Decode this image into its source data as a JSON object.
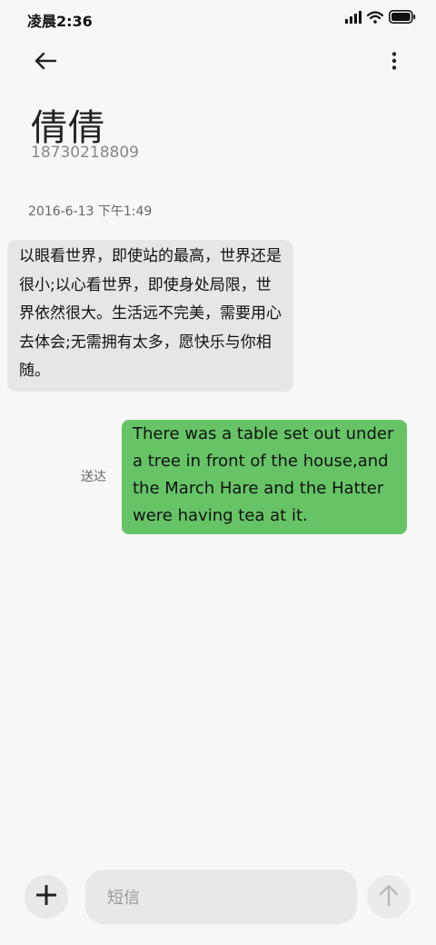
{
  "status_bar": {
    "time": "凌晨2:36",
    "icons": [
      "signal-icon",
      "wifi-icon",
      "battery-icon"
    ]
  },
  "header": {
    "back_icon": "arrow-left-icon",
    "more_icon": "more-vertical-icon"
  },
  "contact": {
    "name": "倩倩",
    "number": "18730218809"
  },
  "conversation": {
    "timestamp": "2016-6-13 下午1:49",
    "incoming_message": "以眼看世界，即使站的最高，世界还是很小;以心看世界，即使身处局限，世界依然很大。生活远不完美，需要用心去体会;无需拥有太多，愿快乐与你相随。",
    "outgoing_message": "There was a table set out under a tree in front of the house,and the March Hare and the Hatter were having tea at it.",
    "outgoing_status": "送达"
  },
  "composer": {
    "placeholder": "短信",
    "add_icon": "plus-icon",
    "send_icon": "arrow-up-icon"
  },
  "colors": {
    "background": "#f7f7f7",
    "incoming_bubble": "#e6e6e6",
    "outgoing_bubble": "#66c466",
    "secondary_text": "#888888"
  }
}
